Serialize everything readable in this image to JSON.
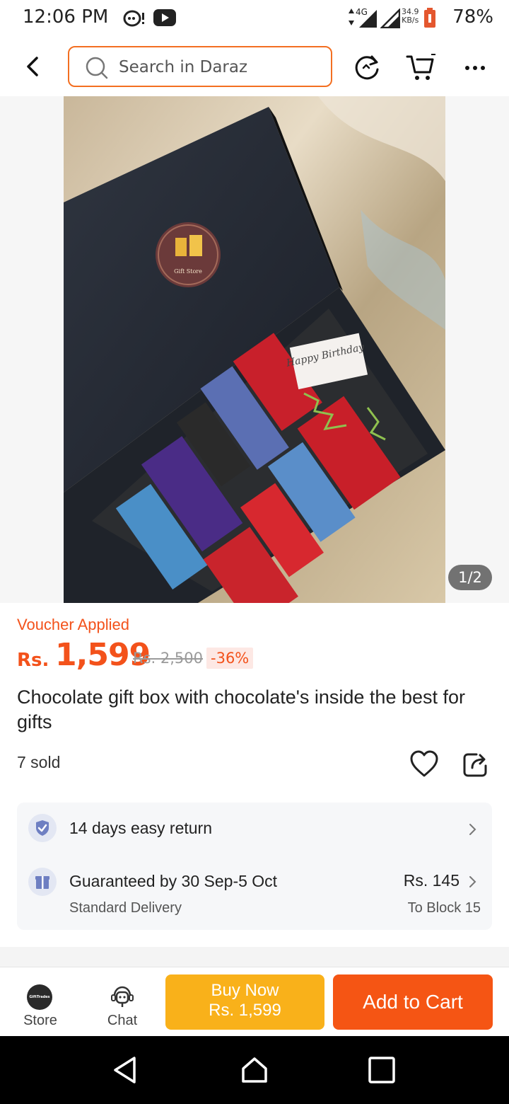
{
  "status_bar": {
    "time": "12:06 PM",
    "network": "4G",
    "speed_value": "34.9",
    "speed_unit": "KB/s",
    "battery": "78%",
    "icons": [
      "notification-icon",
      "youtube-icon",
      "signal-icon",
      "battery-icon"
    ]
  },
  "header": {
    "search_placeholder": "Search in Daraz",
    "icons": [
      "back-arrow-icon",
      "search-icon",
      "refresh-icon",
      "cart-icon",
      "more-icon"
    ],
    "accent_color": "#f36f21"
  },
  "gallery": {
    "counter": "1/2",
    "image_text": {
      "logo_text": "Gift Store",
      "card_text": "Happy Birthday"
    }
  },
  "product": {
    "voucher_label": "Voucher Applied",
    "currency": "Rs.",
    "price": "1,599",
    "original_price": "Rs. 2,500",
    "discount": "-36%",
    "title": "Chocolate gift box with chocolate's inside the best for gifts",
    "sold": "7 sold",
    "price_color": "#f3521b"
  },
  "services": {
    "return_label": "14 days easy return",
    "delivery_label": "Guaranteed by 30 Sep-5 Oct",
    "delivery_type": "Standard Delivery",
    "delivery_fee": "Rs. 145",
    "delivery_location": "To Block 15"
  },
  "actions": {
    "store_label": "Store",
    "store_logo_text": "GiftTrades",
    "chat_label": "Chat",
    "buy_now_label": "Buy Now",
    "buy_now_price": "Rs. 1,599",
    "add_to_cart_label": "Add to Cart",
    "buy_now_color": "#f9b11a",
    "add_to_cart_color": "#f55514"
  },
  "nav": {
    "icons": [
      "back-nav-icon",
      "home-nav-icon",
      "recents-nav-icon"
    ]
  }
}
